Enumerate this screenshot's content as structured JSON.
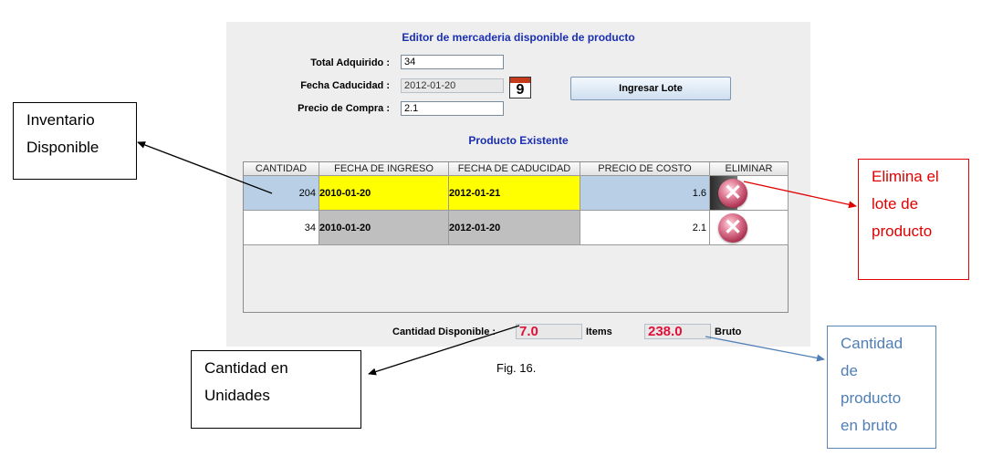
{
  "editor": {
    "title": "Editor de mercaderia disponible de producto",
    "fields": {
      "total_label": "Total Adquirido :",
      "total_value": "34",
      "fecha_label": "Fecha Caducidad :",
      "fecha_value": "2012-01-20",
      "precio_label": "Precio de Compra :",
      "precio_value": "2.1"
    },
    "calendar_day": "9",
    "ingresar_button": "Ingresar Lote",
    "section_title": "Producto Existente",
    "table": {
      "headers": [
        "CANTIDAD",
        "FECHA DE INGRESO",
        "FECHA DE CADUCIDAD",
        "PRECIO DE COSTO",
        "ELIMINAR"
      ],
      "rows": [
        {
          "cantidad": "204",
          "ingreso": "2010-01-20",
          "caducidad": "2012-01-21",
          "precio": "1.6"
        },
        {
          "cantidad": "34",
          "ingreso": "2010-01-20",
          "caducidad": "2012-01-20",
          "precio": "2.1"
        }
      ]
    },
    "footer": {
      "label": "Cantidad Disponible :",
      "items_value": "7.0",
      "items_unit": "Items",
      "bruto_value": "238.0",
      "bruto_unit": "Bruto"
    }
  },
  "caption": "Fig. 16.",
  "callouts": {
    "inventario": [
      "Inventario",
      "Disponible"
    ],
    "unidades": [
      "Cantidad en",
      "Unidades"
    ],
    "elimina": [
      "Elimina el",
      "lote de",
      "producto"
    ],
    "bruto": [
      "Cantidad",
      "de",
      "producto",
      "en bruto"
    ]
  },
  "colors": {
    "title_blue": "#1a2fb0",
    "highlight_yellow": "#ffff00",
    "selected_blue": "#b8cfe6",
    "value_red": "#e0103a",
    "callout_red": "#e00000",
    "callout_blue": "#4f7fb5"
  }
}
